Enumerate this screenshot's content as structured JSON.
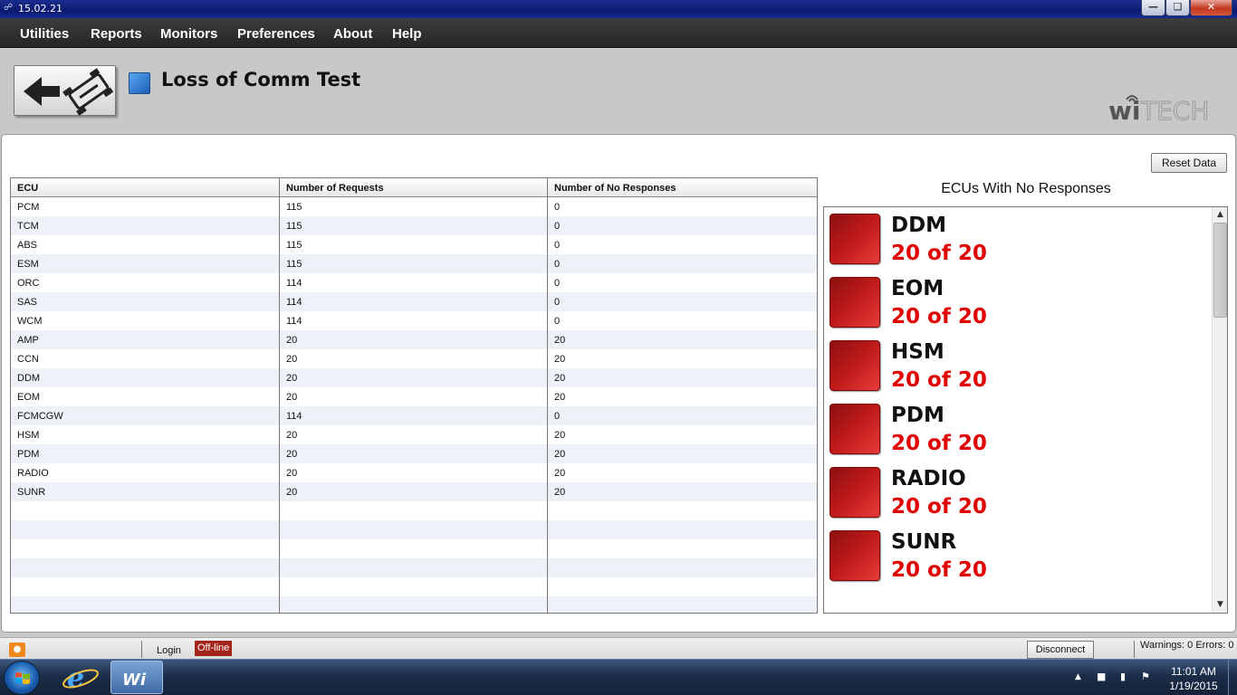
{
  "window": {
    "title": "15.02.21"
  },
  "menu": [
    "Utilities",
    "Reports",
    "Monitors",
    "Preferences",
    "About",
    "Help"
  ],
  "header": {
    "page_title": "Loss of Comm Test",
    "logo_text": "wiTECH"
  },
  "toolbar": {
    "reset_label": "Reset Data"
  },
  "table": {
    "columns": [
      "ECU",
      "Number of Requests",
      "Number of No Responses"
    ],
    "rows": [
      [
        "PCM",
        "115",
        "0"
      ],
      [
        "TCM",
        "115",
        "0"
      ],
      [
        "ABS",
        "115",
        "0"
      ],
      [
        "ESM",
        "115",
        "0"
      ],
      [
        "ORC",
        "114",
        "0"
      ],
      [
        "SAS",
        "114",
        "0"
      ],
      [
        "WCM",
        "114",
        "0"
      ],
      [
        "AMP",
        "20",
        "20"
      ],
      [
        "CCN",
        "20",
        "20"
      ],
      [
        "DDM",
        "20",
        "20"
      ],
      [
        "EOM",
        "20",
        "20"
      ],
      [
        "FCMCGW",
        "114",
        "0"
      ],
      [
        "HSM",
        "20",
        "20"
      ],
      [
        "PDM",
        "20",
        "20"
      ],
      [
        "RADIO",
        "20",
        "20"
      ],
      [
        "SUNR",
        "20",
        "20"
      ]
    ]
  },
  "no_response_panel": {
    "heading": "ECUs With No Responses",
    "items": [
      {
        "name": "DDM",
        "count": "20 of 20"
      },
      {
        "name": "EOM",
        "count": "20 of 20"
      },
      {
        "name": "HSM",
        "count": "20 of 20"
      },
      {
        "name": "PDM",
        "count": "20 of 20"
      },
      {
        "name": "RADIO",
        "count": "20 of 20"
      },
      {
        "name": "SUNR",
        "count": "20 of 20"
      }
    ]
  },
  "statusbar": {
    "login": "Login",
    "status": "Off-line",
    "disconnect": "Disconnect",
    "warnings": "Warnings: 0 Errors: 0"
  },
  "taskbar": {
    "time": "11:01 AM",
    "date": "1/19/2015",
    "wi_label": "Wi"
  },
  "colors": {
    "status_offline": "#a3241a",
    "no_response_red": "#e00000",
    "title_square": "#2b78d4"
  }
}
